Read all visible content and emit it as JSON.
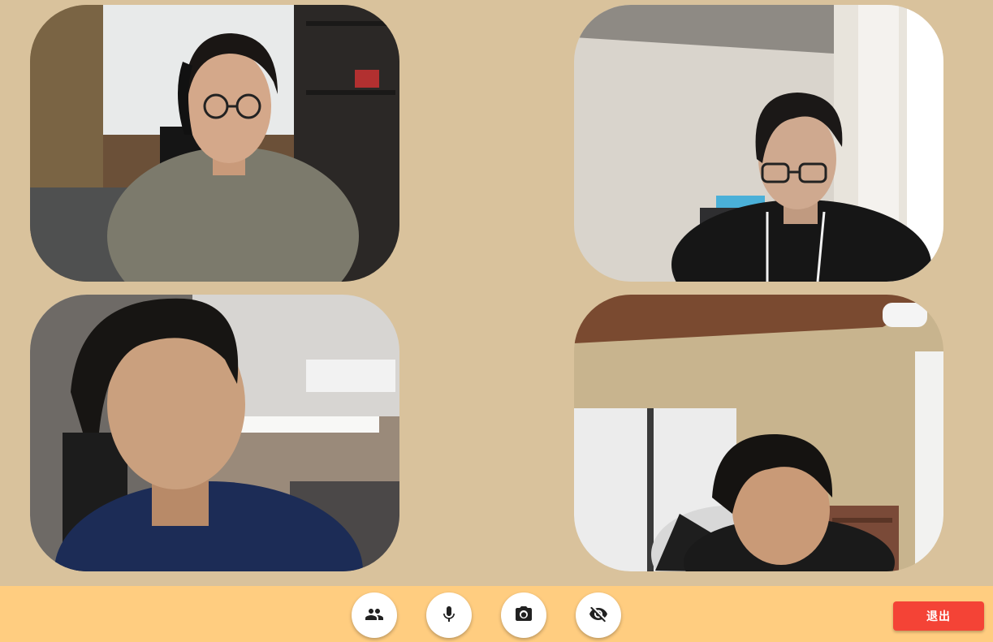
{
  "participants": [
    {
      "id": "p1",
      "video": "participant-video-1"
    },
    {
      "id": "p2",
      "video": "participant-video-2"
    },
    {
      "id": "p3",
      "video": "participant-video-3"
    },
    {
      "id": "p4",
      "video": "participant-video-4"
    }
  ],
  "controls": {
    "people_icon": "people-icon",
    "mic_icon": "microphone-icon",
    "camera_icon": "camera-icon",
    "hide_icon": "eye-off-icon",
    "leave_label": "退出"
  },
  "colors": {
    "background": "#d9c29c",
    "toolbar": "#ffcd80",
    "leave_button": "#f44336"
  }
}
